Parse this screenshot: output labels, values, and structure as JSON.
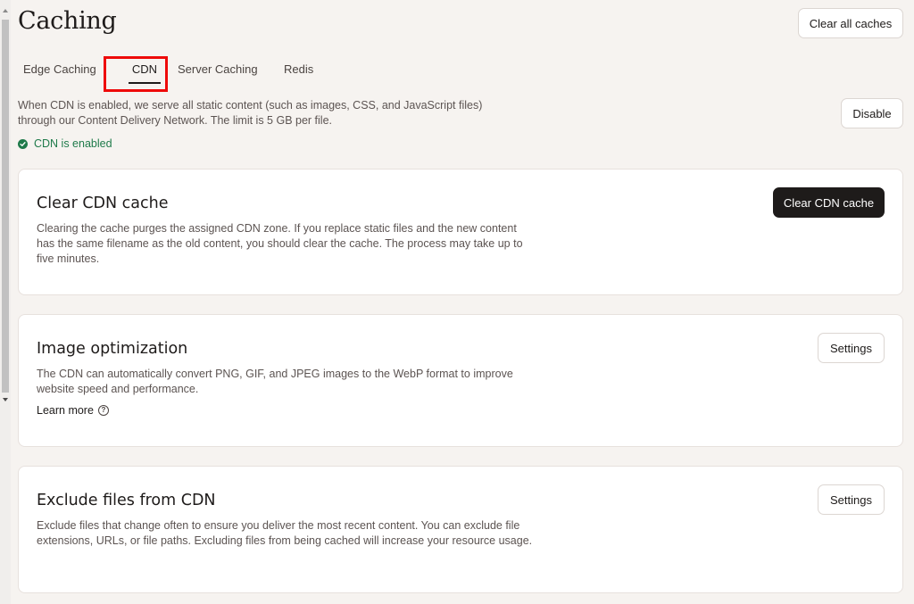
{
  "page": {
    "title": "Caching",
    "clear_all_label": "Clear all caches"
  },
  "tabs": [
    {
      "label": "Edge Caching",
      "active": false
    },
    {
      "label": "CDN",
      "active": true
    },
    {
      "label": "Server Caching",
      "active": false
    },
    {
      "label": "Redis",
      "active": false
    }
  ],
  "cdn": {
    "description": "When CDN is enabled, we serve all static content (such as images, CSS, and JavaScript files) through our Content Delivery Network. The limit is 5 GB per file.",
    "disable_label": "Disable",
    "status_text": "CDN is enabled",
    "status_color": "#1f7a4a"
  },
  "cards": {
    "clear_cdn": {
      "title": "Clear CDN cache",
      "text": "Clearing the cache purges the assigned CDN zone. If you replace static files and the new content has the same filename as the old content, you should clear the cache. The process may take up to five minutes.",
      "button_label": "Clear CDN cache"
    },
    "image_optimization": {
      "title": "Image optimization",
      "text": "The CDN can automatically convert PNG, GIF, and JPEG images to the WebP format to improve website speed and performance.",
      "link_label": "Learn more",
      "button_label": "Settings"
    },
    "exclude_files": {
      "title": "Exclude files from CDN",
      "text": "Exclude files that change often to ensure you deliver the most recent content. You can exclude file extensions, URLs, or file paths. Excluding files from being cached will increase your resource usage.",
      "button_label": "Settings"
    }
  },
  "icons": {
    "status": "check-circle-icon",
    "learn_more": "question-circle-icon"
  },
  "colors": {
    "highlight": "#ee0a0a",
    "primary_button": "#1e1b1a",
    "background": "#f6f3f0"
  }
}
